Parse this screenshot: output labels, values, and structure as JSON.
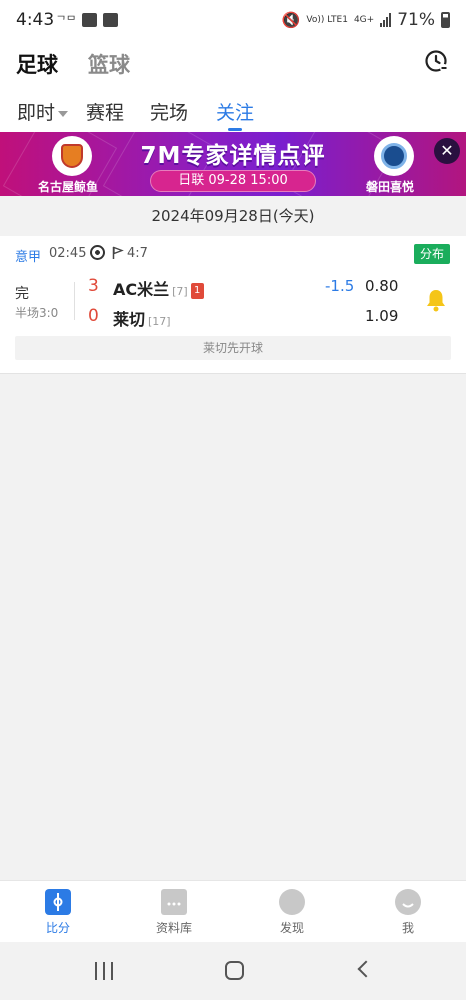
{
  "status_bar": {
    "time": "4:43",
    "carrier": "ᄀᄆ",
    "network_top": "Vo)) LTE1",
    "network_4g": "4G+",
    "battery": "71%"
  },
  "header": {
    "sport_active": "足球",
    "sport_inactive": "篮球"
  },
  "tabs": [
    {
      "label": "即时"
    },
    {
      "label": "赛程"
    },
    {
      "label": "完场"
    },
    {
      "label": "关注"
    }
  ],
  "banner": {
    "title": "7M专家详情点评",
    "match_info": "日联  09-28 15:00",
    "home_team": "名古屋鲸鱼",
    "away_team": "磐田喜悦",
    "close": "✕"
  },
  "date": "2024年09月28日(今天)",
  "match": {
    "league": "意甲",
    "kickoff_time": "02:45",
    "corners": "4:7",
    "distribution_label": "分布",
    "status": "完",
    "half_time": "半场3:0",
    "home": {
      "score": "3",
      "name": "AC米兰",
      "rank": "[7]",
      "red_cards": "1",
      "odds": "0.80"
    },
    "away": {
      "score": "0",
      "name": "莱切",
      "rank": "[17]",
      "odds": "1.09"
    },
    "handicap": "-1.5",
    "kickoff_note": "莱切先开球"
  },
  "bottom_nav": [
    {
      "label": "比分"
    },
    {
      "label": "资料库"
    },
    {
      "label": "发现"
    },
    {
      "label": "我"
    }
  ],
  "colors": {
    "accent": "#2c7be5",
    "score_red": "#e04a3a",
    "distribution_green": "#1aad5c"
  }
}
